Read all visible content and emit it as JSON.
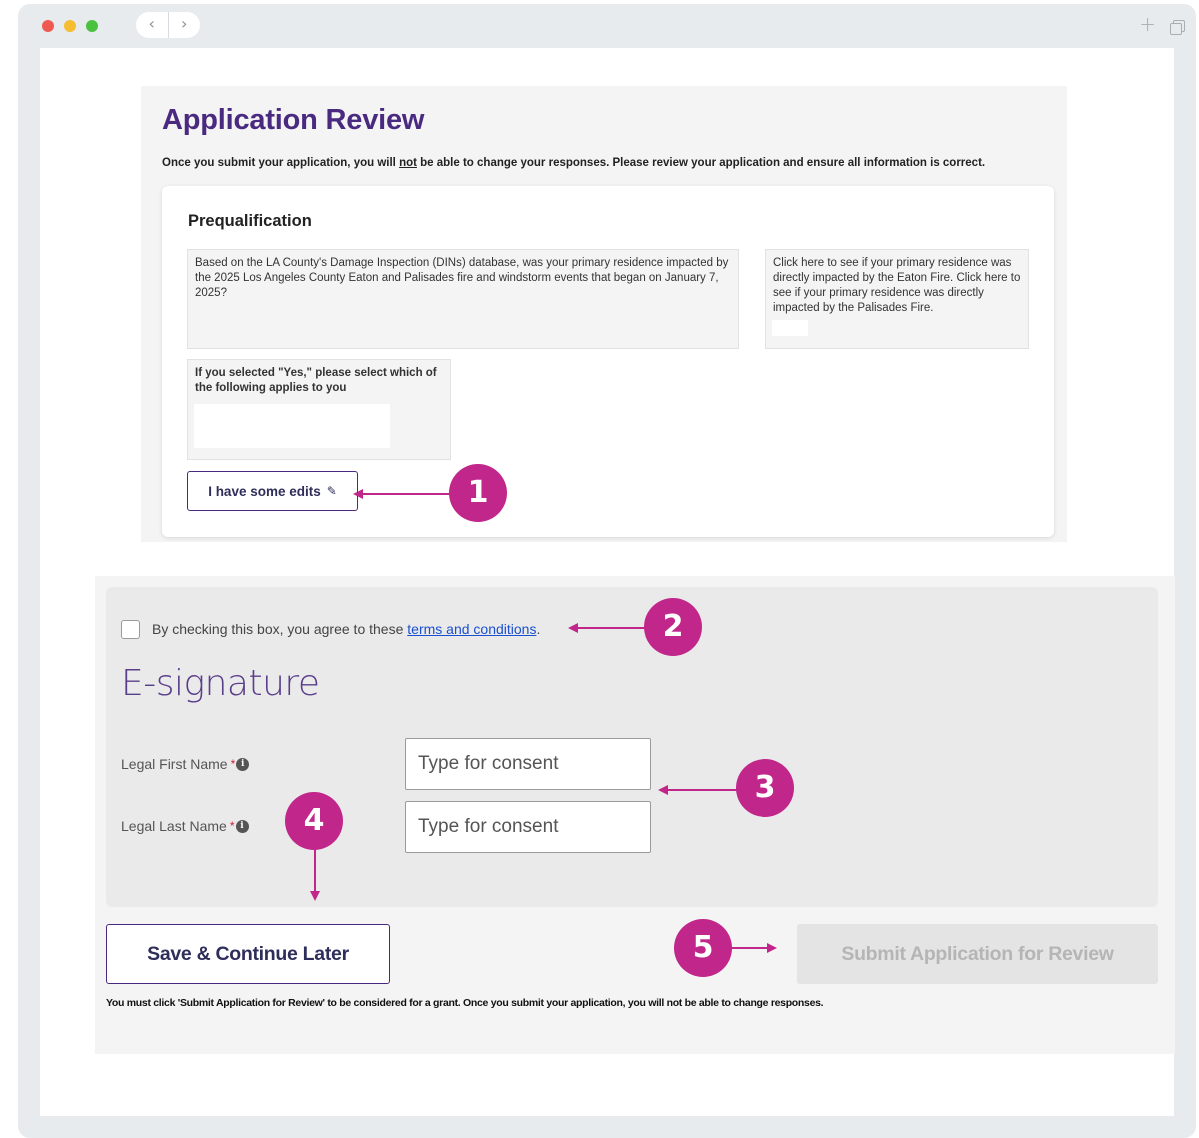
{
  "review": {
    "title": "Application Review",
    "note_before": "Once you submit your application, you will ",
    "note_emphasis": "not",
    "note_after": " be able to change your responses. Please review your application and ensure all information is correct.",
    "section_title": "Prequalification",
    "question_1": "Based on the LA County's Damage Inspection (DINs) database, was your primary residence impacted by the 2025 Los Angeles County Eaton and Palisades fire and windstorm events that began on January 7, 2025?",
    "question_2": "Click here to see if your primary residence was directly impacted by the Eaton Fire. Click here to see if your primary residence was directly impacted by the Palisades Fire.",
    "question_3": "If you selected \"Yes,\" please select which of the following applies to you",
    "edit_button": "I have some edits"
  },
  "consent": {
    "text": "By checking this box, you agree to these ",
    "link": "terms and conditions",
    "suffix": "."
  },
  "esignature": {
    "title": "E-signature",
    "first_name_label": "Legal First Name",
    "last_name_label": "Legal Last Name",
    "required_mark": "*",
    "info_glyph": "i",
    "first_name_placeholder": "Type for consent",
    "last_name_placeholder": "Type for consent"
  },
  "actions": {
    "save_label": "Save & Continue Later",
    "submit_label": "Submit Application for Review",
    "footer_note": "You must click 'Submit Application for Review' to be considered for a grant. Once you submit your application, you will not be able to change responses."
  },
  "callouts": {
    "one": "1",
    "two": "2",
    "three": "3",
    "four": "4",
    "five": "5"
  },
  "titlebar": {
    "back_icon": "‹",
    "forward_icon": "›",
    "new_tab_icon": "+"
  },
  "colors": {
    "brand_purple": "#4a2a80",
    "callout_magenta": "#c1268a",
    "link_blue": "#1a4fcf"
  }
}
